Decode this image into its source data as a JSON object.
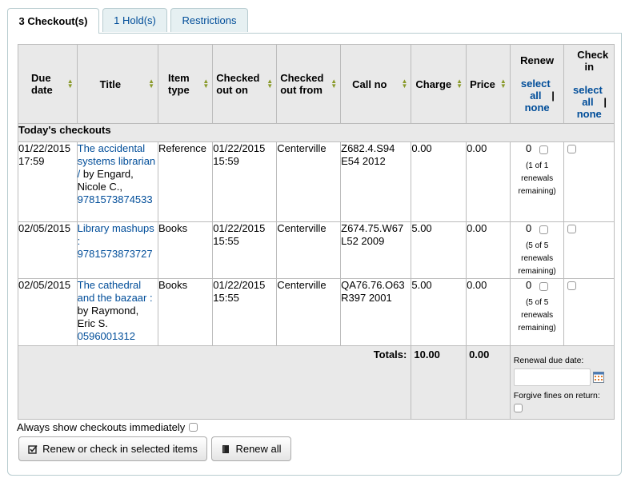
{
  "tabs": [
    {
      "label": "3 Checkout(s)"
    },
    {
      "label": "1 Hold(s)"
    },
    {
      "label": "Restrictions"
    }
  ],
  "headers": {
    "due_date": "Due date",
    "title": "Title",
    "item_type": "Item type",
    "checked_out_on": "Checked out on",
    "checked_out_from": "Checked out from",
    "call_no": "Call no",
    "charge": "Charge",
    "price": "Price",
    "renew": "Renew",
    "check_in": "Check in",
    "select_all": "select all",
    "none": "none",
    "sep": "|"
  },
  "group_label": "Today's checkouts",
  "rows": [
    {
      "due": "01/22/2015 17:59",
      "title": "The accidental systems librarian /",
      "author": "by Engard, Nicole C.,",
      "isbn": "9781573874533",
      "item_type": "Reference",
      "checked_out_on": "01/22/2015 15:59",
      "from": "Centerville",
      "call_no": "Z682.4.S94 E54 2012",
      "charge": "0.00",
      "price": "0.00",
      "renew_count": "0",
      "renew_note": "(1 of 1 renewals remaining)"
    },
    {
      "due": "02/05/2015",
      "title": "Library mashups :",
      "author": "",
      "isbn": "9781573873727",
      "item_type": "Books",
      "checked_out_on": "01/22/2015 15:55",
      "from": "Centerville",
      "call_no": "Z674.75.W67 L52 2009",
      "charge": "5.00",
      "price": "0.00",
      "renew_count": "0",
      "renew_note": "(5 of 5 renewals remaining)"
    },
    {
      "due": "02/05/2015",
      "title": "The cathedral and the bazaar :",
      "author": "by Raymond, Eric S.",
      "isbn": "0596001312",
      "item_type": "Books",
      "checked_out_on": "01/22/2015 15:55",
      "from": "Centerville",
      "call_no": "QA76.76.O63 R397 2001",
      "charge": "5.00",
      "price": "0.00",
      "renew_count": "0",
      "renew_note": "(5 of 5 renewals remaining)"
    }
  ],
  "totals": {
    "label": "Totals:",
    "charge": "10.00",
    "price": "0.00",
    "renewal_due_label": "Renewal due date:",
    "forgive_label": "Forgive fines on return:"
  },
  "always_show_label": "Always show checkouts immediately",
  "buttons": {
    "renew_checkin": "Renew or check in selected items",
    "renew_all": "Renew all"
  },
  "colors": {
    "link": "#004d99",
    "header_bg": "#e9e9e9",
    "tab_bg": "#e6f0f2"
  },
  "icons": {
    "calendar": "calendar-icon",
    "checkbox_edit": "check-square-icon",
    "book": "book-icon"
  }
}
